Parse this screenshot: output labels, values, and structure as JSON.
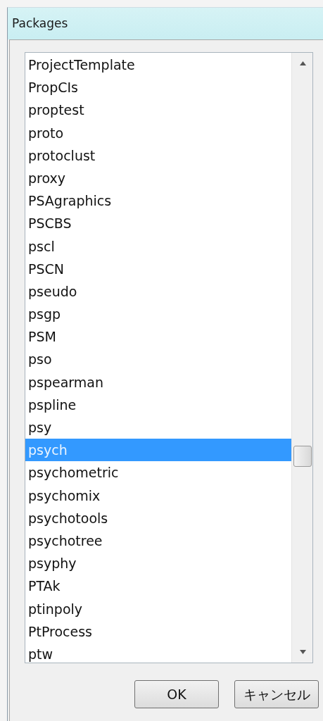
{
  "window": {
    "title": "Packages"
  },
  "list": {
    "items": [
      {
        "label": "ProjectTemplate",
        "selected": false
      },
      {
        "label": "PropCIs",
        "selected": false
      },
      {
        "label": "proptest",
        "selected": false
      },
      {
        "label": "proto",
        "selected": false
      },
      {
        "label": "protoclust",
        "selected": false
      },
      {
        "label": "proxy",
        "selected": false
      },
      {
        "label": "PSAgraphics",
        "selected": false
      },
      {
        "label": "PSCBS",
        "selected": false
      },
      {
        "label": "pscl",
        "selected": false
      },
      {
        "label": "PSCN",
        "selected": false
      },
      {
        "label": "pseudo",
        "selected": false
      },
      {
        "label": "psgp",
        "selected": false
      },
      {
        "label": "PSM",
        "selected": false
      },
      {
        "label": "pso",
        "selected": false
      },
      {
        "label": "pspearman",
        "selected": false
      },
      {
        "label": "pspline",
        "selected": false
      },
      {
        "label": "psy",
        "selected": false
      },
      {
        "label": "psych",
        "selected": true
      },
      {
        "label": "psychometric",
        "selected": false
      },
      {
        "label": "psychomix",
        "selected": false
      },
      {
        "label": "psychotools",
        "selected": false
      },
      {
        "label": "psychotree",
        "selected": false
      },
      {
        "label": "psyphy",
        "selected": false
      },
      {
        "label": "PTAk",
        "selected": false
      },
      {
        "label": "ptinpoly",
        "selected": false
      },
      {
        "label": "PtProcess",
        "selected": false
      },
      {
        "label": "ptw",
        "selected": false
      }
    ]
  },
  "buttons": [
    {
      "label": "OK"
    },
    {
      "label": "キャンセル"
    }
  ]
}
